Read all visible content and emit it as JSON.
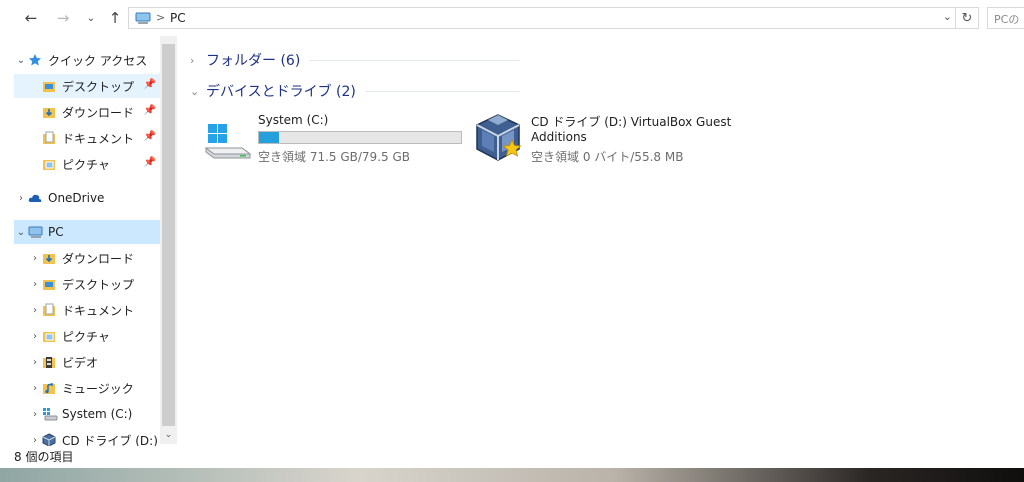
{
  "window": {
    "address": {
      "crumb": "PC"
    },
    "search": {
      "placeholder": "PCの"
    }
  },
  "nav": {
    "quick_access": "クイック アクセス",
    "quick_items": [
      "デスクトップ",
      "ダウンロード",
      "ドキュメント",
      "ピクチャ"
    ],
    "onedrive": "OneDrive",
    "pc": "PC",
    "pc_items": [
      "ダウンロード",
      "デスクトップ",
      "ドキュメント",
      "ピクチャ",
      "ビデオ",
      "ミュージック",
      "System (C:)",
      "CD ドライブ (D:) V"
    ]
  },
  "content": {
    "folders_group": "フォルダー (6)",
    "devices_group": "デバイスとドライブ (2)",
    "drives": [
      {
        "name": "System (C:)",
        "size_text": "空き領域 71.5 GB/79.5 GB",
        "used_fraction": 0.1,
        "icon": "windows-drive-icon"
      },
      {
        "name_line1": "CD ドライブ (D:) VirtualBox Guest",
        "name_line2": "Additions",
        "size_text": "空き領域 0 バイト/55.8 MB",
        "icon": "virtualbox-cd-icon"
      }
    ]
  },
  "status": {
    "item_count": "8 個の項目"
  },
  "colors": {
    "accent": "#26a0da",
    "selection": "#cce8ff",
    "group_title": "#1e3287"
  }
}
